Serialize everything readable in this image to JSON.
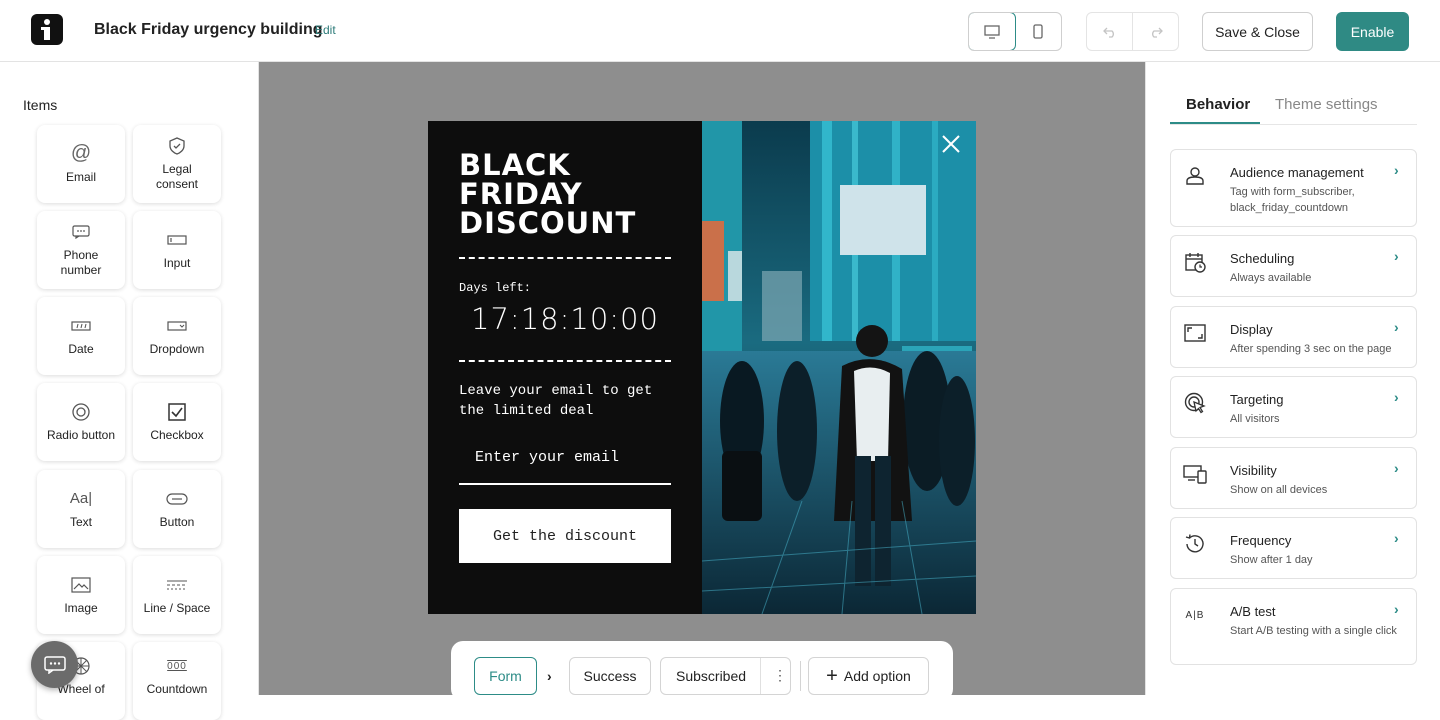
{
  "header": {
    "title": "Black Friday urgency building",
    "edit_label": "Edit",
    "save_close_label": "Save & Close",
    "enable_label": "Enable",
    "accent_color": "#2f8a84"
  },
  "sidebar": {
    "heading": "Items",
    "tiles": [
      {
        "label": "Email",
        "icon": "at-icon"
      },
      {
        "label": "Legal consent",
        "icon": "shield-check-icon"
      },
      {
        "label": "Phone number",
        "icon": "phone-chat-icon"
      },
      {
        "label": "Input",
        "icon": "input-icon"
      },
      {
        "label": "Date",
        "icon": "date-icon"
      },
      {
        "label": "Dropdown",
        "icon": "dropdown-icon"
      },
      {
        "label": "Radio button",
        "icon": "radio-icon"
      },
      {
        "label": "Checkbox",
        "icon": "checkbox-icon"
      },
      {
        "label": "Text",
        "icon": "text-icon",
        "glyph": "Aa|"
      },
      {
        "label": "Button",
        "icon": "button-icon"
      },
      {
        "label": "Image",
        "icon": "image-icon"
      },
      {
        "label": "Line / Space",
        "icon": "line-space-icon"
      },
      {
        "label": "Wheel of",
        "icon": "wheel-icon"
      },
      {
        "label": "Countdown",
        "icon": "countdown-icon",
        "glyph": "000"
      }
    ]
  },
  "popup": {
    "title_lines": [
      "BLACK",
      "FRIDAY",
      "DISCOUNT"
    ],
    "days_left_label": "Days left:",
    "countdown": "17:18:10:00",
    "lead_text": "Leave your email to get the limited deal",
    "email_placeholder": "Enter your email",
    "cta_label": "Get the discount"
  },
  "steps": {
    "items": [
      "Form",
      "Success",
      "Subscribed"
    ],
    "add_option_label": "Add option"
  },
  "right_panel": {
    "tabs": [
      "Behavior",
      "Theme settings"
    ],
    "cards": [
      {
        "title": "Audience management",
        "subtitle": "Tag with form_subscriber, black_friday_countdown",
        "icon": "person-icon"
      },
      {
        "title": "Scheduling",
        "subtitle": "Always available",
        "icon": "calendar-clock-icon"
      },
      {
        "title": "Display",
        "subtitle": "After spending 3 sec on the page",
        "icon": "display-frame-icon"
      },
      {
        "title": "Targeting",
        "subtitle": "All visitors",
        "icon": "target-cursor-icon"
      },
      {
        "title": "Visibility",
        "subtitle": "Show on all devices",
        "icon": "devices-icon"
      },
      {
        "title": "Frequency",
        "subtitle": "Show after 1 day",
        "icon": "history-icon"
      },
      {
        "title": "A/B test",
        "subtitle": "Start A/B testing with a single click",
        "icon": "ab-icon",
        "glyph": "A|B"
      }
    ]
  }
}
